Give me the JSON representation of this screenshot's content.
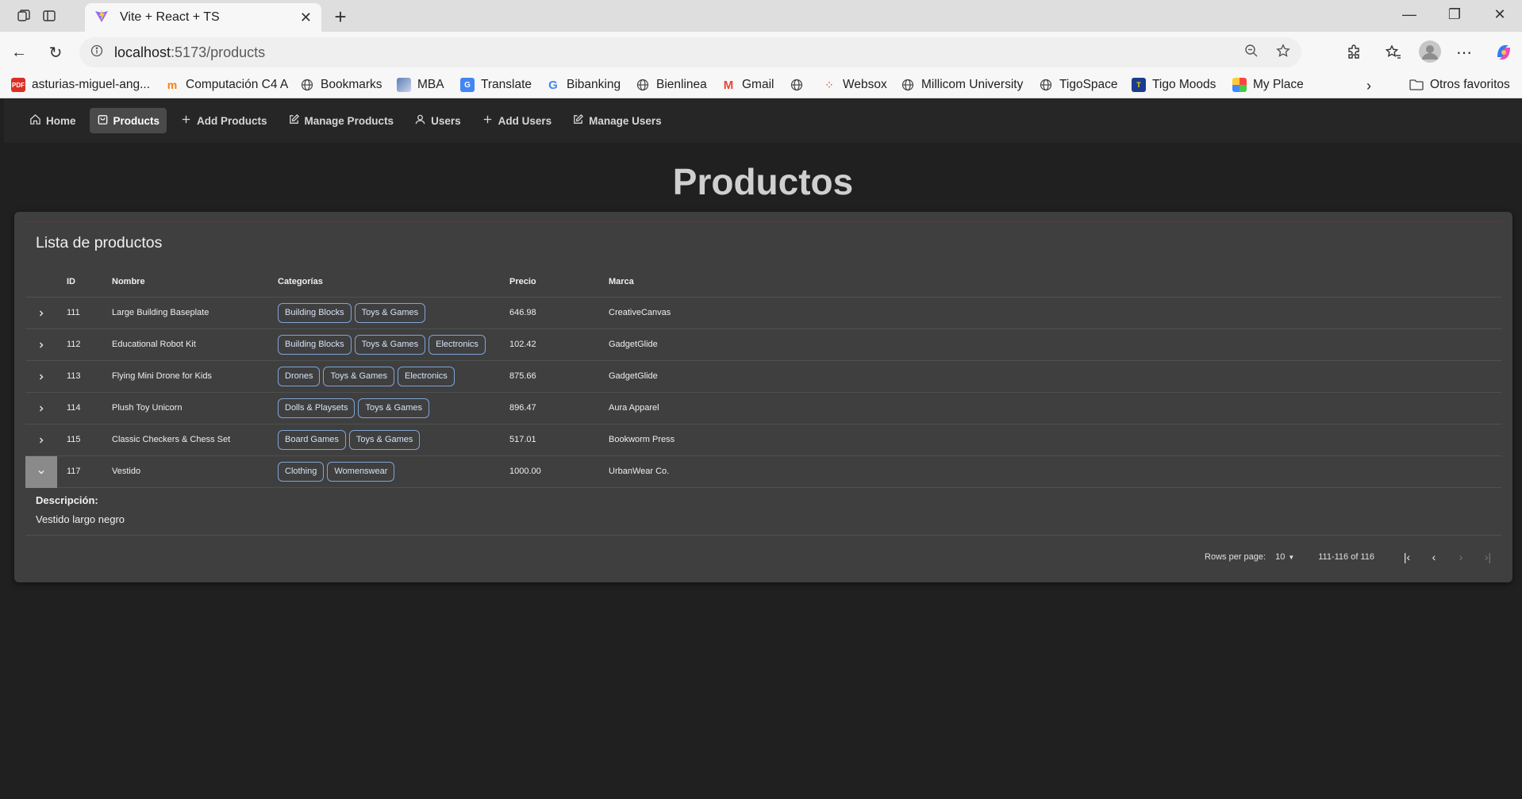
{
  "browser": {
    "tab_title": "Vite + React + TS",
    "url_host": "localhost",
    "url_path": ":5173/products",
    "bookmarks": [
      {
        "label": "asturias-miguel-ang...",
        "icon": "pdf-icon"
      },
      {
        "label": "Computación C4 A",
        "icon": "moodle-icon"
      },
      {
        "label": "Bookmarks",
        "icon": "globe-icon"
      },
      {
        "label": "MBA",
        "icon": "site-icon"
      },
      {
        "label": "Translate",
        "icon": "translate-icon"
      },
      {
        "label": "Bibanking",
        "icon": "google-icon"
      },
      {
        "label": "Bienlinea",
        "icon": "globe-icon"
      },
      {
        "label": "Gmail",
        "icon": "gmail-icon"
      },
      {
        "label": "",
        "icon": "globe-icon"
      },
      {
        "label": "Websox",
        "icon": "loader-icon"
      },
      {
        "label": "Millicom University",
        "icon": "globe-icon"
      },
      {
        "label": "TigoSpace",
        "icon": "globe-icon"
      },
      {
        "label": "Tigo Moods",
        "icon": "tigo-icon"
      },
      {
        "label": "My Place",
        "icon": "myplace-icon"
      }
    ],
    "other_favorites": "Otros favoritos"
  },
  "nav": {
    "items": [
      {
        "label": "Home",
        "icon": "home-icon"
      },
      {
        "label": "Products",
        "icon": "bag-icon",
        "active": true
      },
      {
        "label": "Add Products",
        "icon": "plus-icon"
      },
      {
        "label": "Manage Products",
        "icon": "edit-icon"
      },
      {
        "label": "Users",
        "icon": "user-icon"
      },
      {
        "label": "Add Users",
        "icon": "plus-icon"
      },
      {
        "label": "Manage Users",
        "icon": "edit-icon"
      }
    ]
  },
  "page_title": "Productos",
  "table": {
    "title": "Lista de productos",
    "columns": {
      "id": "ID",
      "name": "Nombre",
      "categories": "Categorías",
      "price": "Precio",
      "brand": "Marca"
    },
    "rows": [
      {
        "id": "111",
        "name": "Large Building Baseplate",
        "categories": [
          "Building Blocks",
          "Toys & Games"
        ],
        "price": "646.98",
        "brand": "CreativeCanvas",
        "expanded": false
      },
      {
        "id": "112",
        "name": "Educational Robot Kit",
        "categories": [
          "Building Blocks",
          "Toys & Games",
          "Electronics"
        ],
        "price": "102.42",
        "brand": "GadgetGlide",
        "expanded": false
      },
      {
        "id": "113",
        "name": "Flying Mini Drone for Kids",
        "categories": [
          "Drones",
          "Toys & Games",
          "Electronics"
        ],
        "price": "875.66",
        "brand": "GadgetGlide",
        "expanded": false
      },
      {
        "id": "114",
        "name": "Plush Toy Unicorn",
        "categories": [
          "Dolls & Playsets",
          "Toys & Games"
        ],
        "price": "896.47",
        "brand": "Aura Apparel",
        "expanded": false
      },
      {
        "id": "115",
        "name": "Classic Checkers & Chess Set",
        "categories": [
          "Board Games",
          "Toys & Games"
        ],
        "price": "517.01",
        "brand": "Bookworm Press",
        "expanded": false
      },
      {
        "id": "117",
        "name": "Vestido",
        "categories": [
          "Clothing",
          "Womenswear"
        ],
        "price": "1000.00",
        "brand": "UrbanWear Co.",
        "expanded": true
      }
    ],
    "detail": {
      "label": "Descripción:",
      "text": "Vestido largo negro"
    },
    "pagination": {
      "rows_per_page_label": "Rows per page:",
      "rows_per_page": "10",
      "range": "111-116 of 116"
    }
  },
  "colors": {
    "accent_chip_border": "#7fa3d4",
    "background": "#202020",
    "card": "#3f3f3f"
  }
}
